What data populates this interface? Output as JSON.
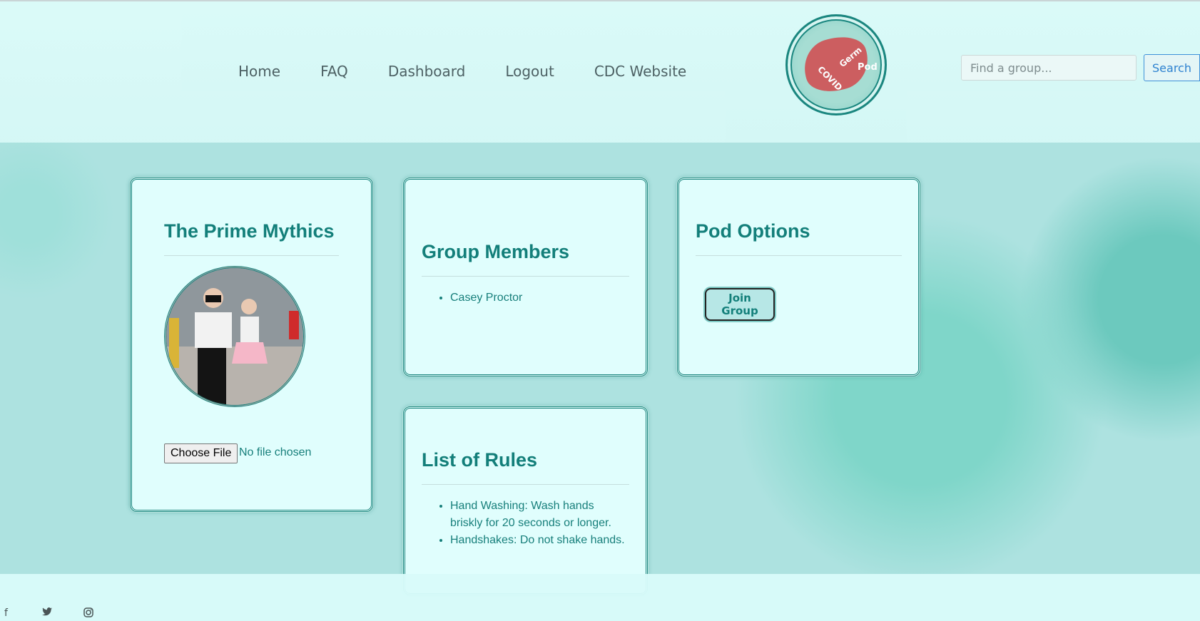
{
  "nav": {
    "items": [
      {
        "label": "Home"
      },
      {
        "label": "FAQ"
      },
      {
        "label": "Dashboard"
      },
      {
        "label": "Logout"
      },
      {
        "label": "CDC Website"
      }
    ]
  },
  "logo": {
    "words": [
      "COVID",
      "Germ",
      "Pod"
    ]
  },
  "search": {
    "placeholder": "Find a group...",
    "button_label": "Search"
  },
  "group_card": {
    "title": "The Prime Mythics",
    "choose_file_label": "Choose File",
    "file_status": "No file chosen"
  },
  "members_card": {
    "title": "Group Members",
    "members": [
      "Casey Proctor"
    ]
  },
  "options_card": {
    "title": "Pod Options",
    "join_label": "Join Group"
  },
  "rules_card": {
    "title": "List of Rules",
    "rules": [
      "Hand Washing: Wash hands briskly for 20 seconds or longer.",
      "Handshakes: Do not shake hands."
    ]
  },
  "footer": {
    "social_icons": [
      "facebook-icon",
      "twitter-icon",
      "instagram-icon"
    ]
  },
  "colors": {
    "accent": "#137f7a",
    "card_bg": "#e0fefd",
    "search_blue": "#2a7fd0"
  }
}
